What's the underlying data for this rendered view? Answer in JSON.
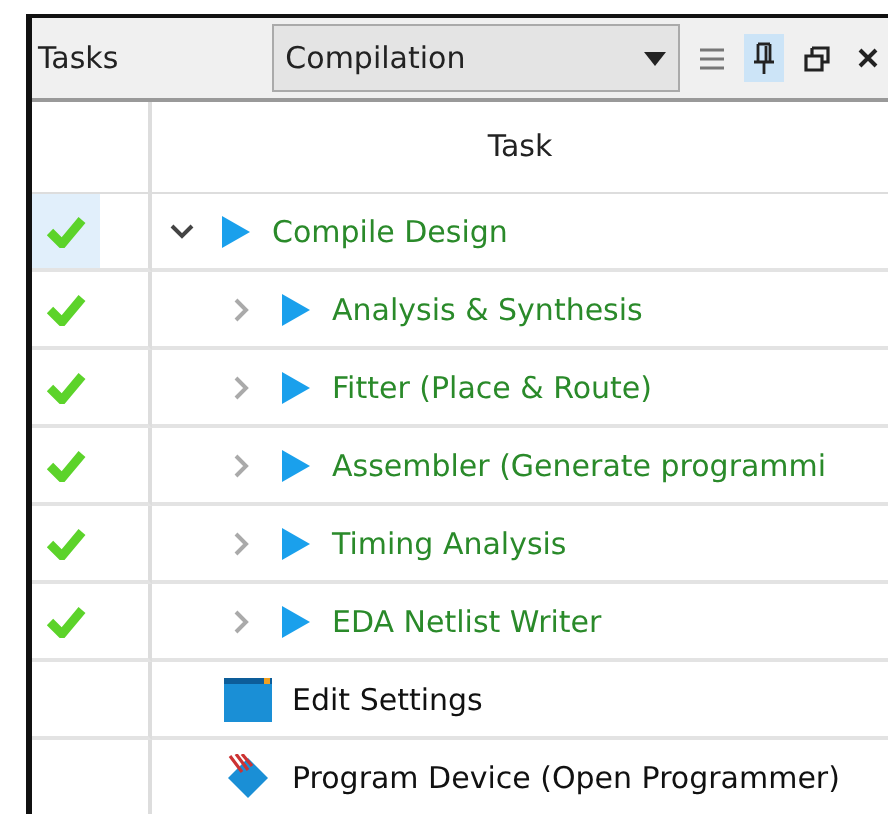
{
  "panel": {
    "title": "Tasks",
    "flow_dropdown": {
      "value": "Compilation"
    }
  },
  "table": {
    "columns": [
      "Task"
    ],
    "rows": [
      {
        "label": "Compile Design",
        "kind": "flow",
        "done": true,
        "expanded": true,
        "selected": true,
        "children": [
          {
            "label": "Analysis & Synthesis",
            "kind": "flow",
            "done": true,
            "expanded": false,
            "selected": false
          },
          {
            "label": "Fitter (Place & Route)",
            "kind": "flow",
            "done": true,
            "expanded": false,
            "selected": false
          },
          {
            "label": "Assembler (Generate programmi",
            "kind": "flow",
            "done": true,
            "expanded": false,
            "selected": false
          },
          {
            "label": "Timing Analysis",
            "kind": "flow",
            "done": true,
            "expanded": false,
            "selected": false
          },
          {
            "label": "EDA Netlist Writer",
            "kind": "flow",
            "done": true,
            "expanded": false,
            "selected": false
          }
        ]
      },
      {
        "label": "Edit Settings",
        "kind": "settings",
        "selected": false
      },
      {
        "label": "Program Device (Open Programmer)",
        "kind": "program",
        "selected": false
      }
    ]
  }
}
